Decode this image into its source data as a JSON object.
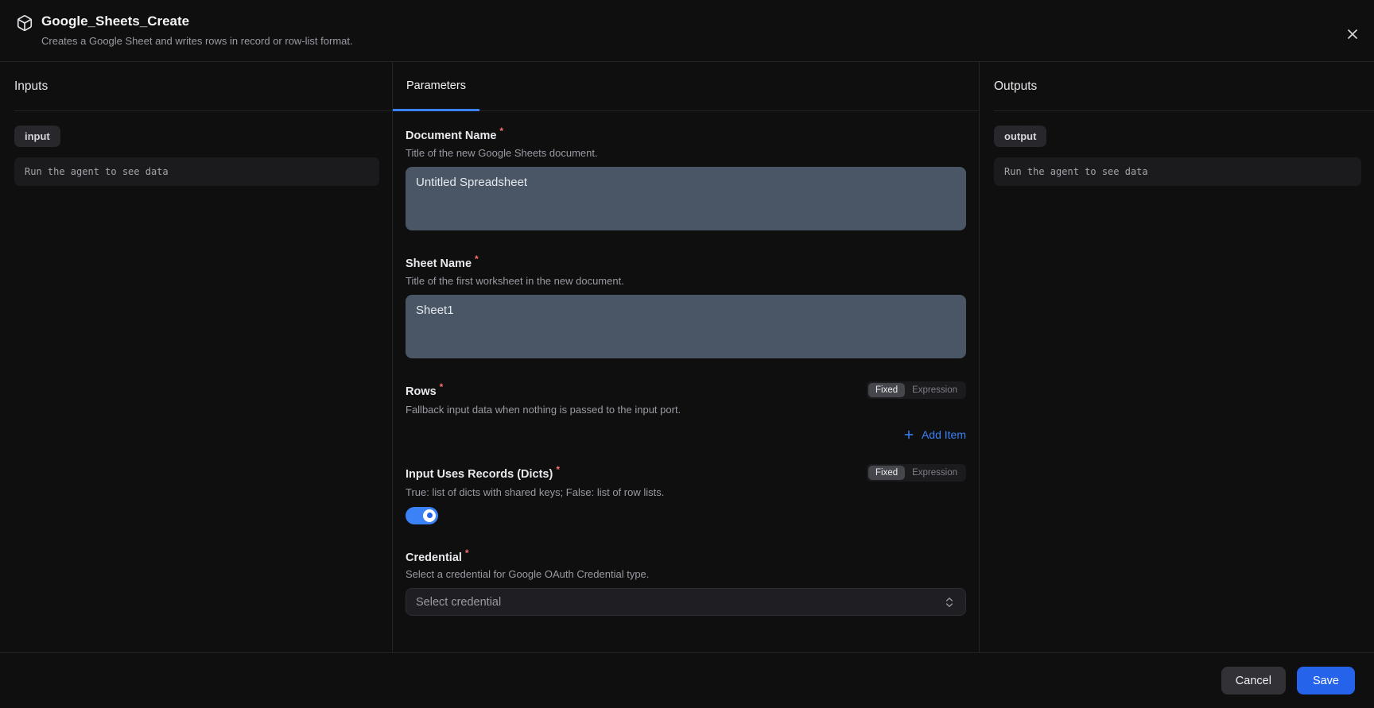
{
  "header": {
    "title": "Google_Sheets_Create",
    "subtitle": "Creates a Google Sheet and writes rows in record or row-list format."
  },
  "inputs_panel": {
    "heading": "Inputs",
    "port_badge": "input",
    "data_text": "Run the agent to see data"
  },
  "parameters_panel": {
    "tab_label": "Parameters",
    "required_marker": "*",
    "mode_toggle": {
      "fixed_label": "Fixed",
      "expression_label": "Expression",
      "selected": "Fixed"
    },
    "fields": {
      "document_name": {
        "label": "Document Name",
        "required": true,
        "helper": "Title of the new Google Sheets document.",
        "value": "Untitled Spreadsheet"
      },
      "sheet_name": {
        "label": "Sheet Name",
        "required": true,
        "helper": "Title of the first worksheet in the new document.",
        "value": "Sheet1"
      },
      "rows": {
        "label": "Rows",
        "required": true,
        "helper": "Fallback input data when nothing is passed to the input port.",
        "add_item_label": "Add Item",
        "mode": "Fixed"
      },
      "input_uses_records": {
        "label": "Input Uses Records (Dicts)",
        "required": true,
        "helper": "True: list of dicts with shared keys; False: list of row lists.",
        "toggle_state": "on",
        "mode": "Fixed"
      },
      "credential": {
        "label": "Credential",
        "required": true,
        "helper": "Select a credential for Google OAuth Credential type.",
        "placeholder": "Select credential"
      }
    }
  },
  "outputs_panel": {
    "heading": "Outputs",
    "port_badge": "output",
    "data_text": "Run the agent to see data"
  },
  "footer": {
    "cancel_label": "Cancel",
    "save_label": "Save"
  },
  "colors": {
    "accent_blue": "#3b82f6",
    "save_blue": "#2563eb",
    "required_red": "#f87171",
    "field_slate": "#4a5666",
    "background": "#0f0f10"
  }
}
